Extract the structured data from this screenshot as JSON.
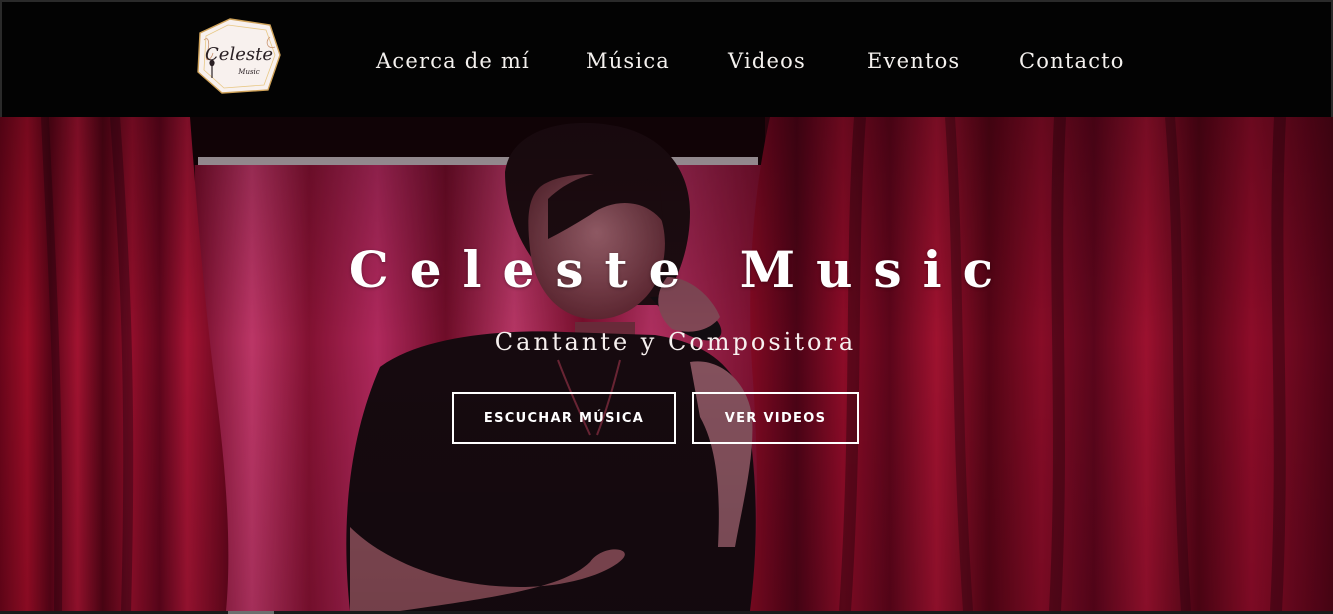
{
  "brand": {
    "logo_text": "Celeste",
    "logo_subtext": "Music"
  },
  "nav": {
    "items": [
      {
        "label": "Acerca de mí"
      },
      {
        "label": "Música"
      },
      {
        "label": "Videos"
      },
      {
        "label": "Eventos"
      },
      {
        "label": "Contacto"
      }
    ]
  },
  "hero": {
    "title": "Celeste Music",
    "subtitle": "Cantante y Compositora",
    "buttons": {
      "listen_label": "ESCUCHAR MÚSICA",
      "videos_label": "VER VIDEOS"
    }
  },
  "colors": {
    "header_background": "#030303",
    "curtain_red": "#a3122d",
    "text_light": "#ffffff"
  },
  "icons": {
    "logo": "celeste-music-logo-icon"
  }
}
